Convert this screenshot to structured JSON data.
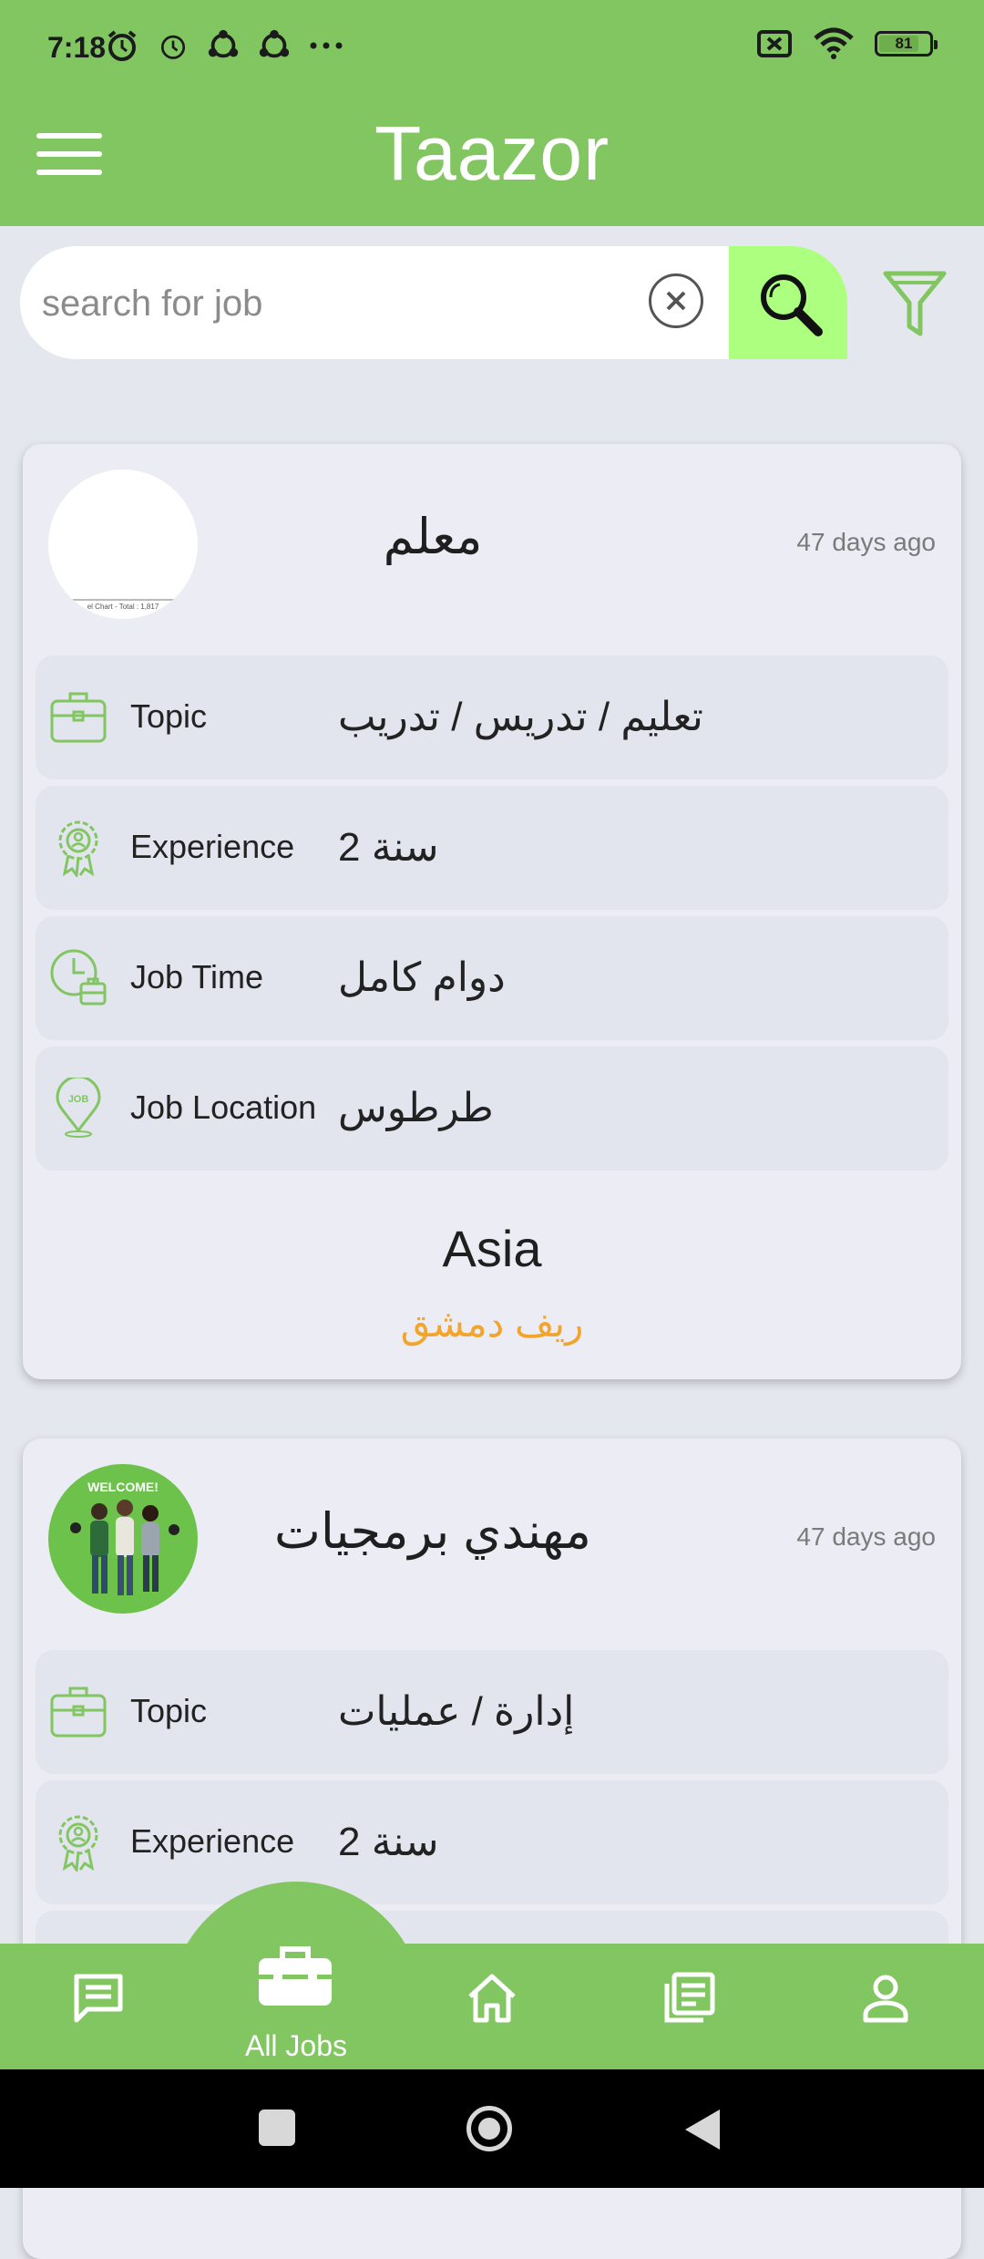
{
  "status_bar": {
    "time": "7:18",
    "battery": "81",
    "battery_level": 0.81
  },
  "header": {
    "title": "Taazor"
  },
  "search": {
    "placeholder": "search for job",
    "value": ""
  },
  "jobs": [
    {
      "avatar_caption": "el Chart - Total : 1,817",
      "title": "معلم",
      "posted": "47 days ago",
      "fields": [
        {
          "label": "Topic",
          "value": "تعليم / تدريس / تدريب",
          "icon": "briefcase-icon"
        },
        {
          "label": "Experience",
          "value": "2 سنة",
          "icon": "award-icon"
        },
        {
          "label": "Job Time",
          "value": "دوام كامل",
          "icon": "clock-briefcase-icon"
        },
        {
          "label": "Job Location",
          "value": "طرطوس",
          "icon": "job-location-pin-icon"
        }
      ],
      "region": "Asia",
      "city": "ريف دمشق"
    },
    {
      "avatar_text": "WELCOME!",
      "title": "مهندي برمجيات",
      "posted": "47 days ago",
      "fields": [
        {
          "label": "Topic",
          "value": "إدارة / عمليات",
          "icon": "briefcase-icon"
        },
        {
          "label": "Experience",
          "value": "2 سنة",
          "icon": "award-icon"
        }
      ]
    }
  ],
  "bottom_nav": {
    "items": [
      {
        "name": "messages",
        "icon": "chat-icon"
      },
      {
        "name": "all-jobs",
        "label": "All Jobs",
        "icon": "toolbox-icon",
        "active": true
      },
      {
        "name": "home",
        "icon": "home-icon"
      },
      {
        "name": "articles",
        "icon": "newspaper-icon"
      },
      {
        "name": "profile",
        "icon": "person-icon"
      }
    ]
  },
  "colors": {
    "primary": "#82C662",
    "search_button": "#ADFF7F",
    "city_text": "#F2A52C",
    "background": "#E5E7EF"
  }
}
